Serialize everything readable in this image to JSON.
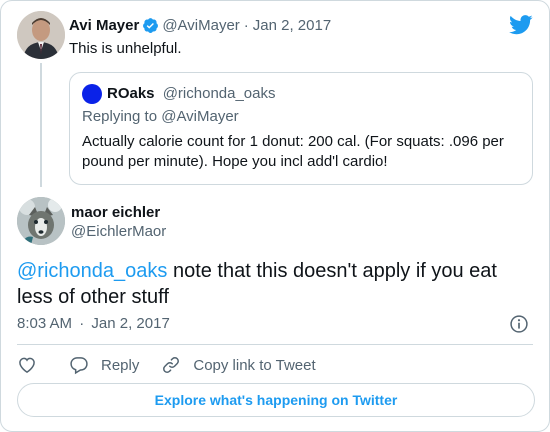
{
  "parent_tweet": {
    "author_name": "Avi Mayer",
    "handle": "@AviMayer",
    "separator": "·",
    "date": "Jan 2, 2017",
    "text": "This is unhelpful.",
    "verified": true
  },
  "quoted_tweet": {
    "author_name": "ROaks",
    "handle": "@richonda_oaks",
    "replying_to": "Replying to @AviMayer",
    "text": "Actually calorie count for 1 donut:  200 cal.  (For squats:  .096 per pound per minute).  Hope you incl add'l cardio!",
    "avatar_color": "#0a22e8"
  },
  "main_tweet": {
    "author_name": "maor eichler",
    "handle": "@EichlerMaor",
    "mention": "@richonda_oaks",
    "text": " note that this doesn't apply if you eat less of other stuff",
    "time": "8:03 AM",
    "separator": "·",
    "date": "Jan 2, 2017"
  },
  "actions": {
    "like_icon": "heart-icon",
    "reply_label": "Reply",
    "copy_link_label": "Copy link to Tweet"
  },
  "footer": {
    "explore_label": "Explore what's happening on Twitter"
  },
  "colors": {
    "accent": "#1d9bf0",
    "text": "#0f1419",
    "muted": "#536471",
    "border": "#cfd9de"
  }
}
